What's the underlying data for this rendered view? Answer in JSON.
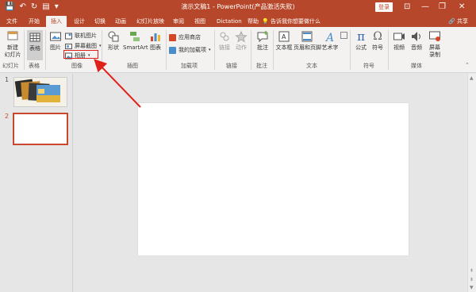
{
  "window": {
    "title": "演示文稿1  -  PowerPoint(产品激活失败)",
    "login_label": "登录",
    "minimize": "—",
    "restore": "❐",
    "close": "✕",
    "ribbon_options": "⊡"
  },
  "quick_access": {
    "save": "💾",
    "undo": "↶",
    "redo": "↻",
    "start": "▤",
    "more": "▾"
  },
  "tabs": [
    {
      "label": "文件"
    },
    {
      "label": "开始"
    },
    {
      "label": "插入"
    },
    {
      "label": "设计"
    },
    {
      "label": "切换"
    },
    {
      "label": "动画"
    },
    {
      "label": "幻灯片放映"
    },
    {
      "label": "审阅"
    },
    {
      "label": "视图"
    },
    {
      "label": "Dictation"
    },
    {
      "label": "帮助"
    }
  ],
  "active_tab": "插入",
  "tell_me": "💡 告诉我你想要做什么",
  "share": "🔗 共享",
  "ribbon": {
    "new_slide": "新建\n幻灯片",
    "table": "表格",
    "picture": "图片",
    "online_pictures": "联机图片",
    "screenshot": "屏幕截图",
    "album": "相册",
    "shapes": "形状",
    "smartart": "SmartArt",
    "chart": "图表",
    "store": "应用商店",
    "my_addins": "我的加载项",
    "link": "链接",
    "action": "动作",
    "comment": "批注",
    "textbox": "文本框",
    "header_footer": "页眉和页脚",
    "wordart": "艺术字",
    "equation": "公式",
    "symbol": "符号",
    "video": "视频",
    "audio": "音频",
    "screen_recording": "屏幕\n录制"
  },
  "groups": {
    "slides": "幻灯片",
    "tables": "表格",
    "images": "图像",
    "illustrations": "插图",
    "addins": "加载项",
    "links": "链接",
    "comments": "批注",
    "text": "文本",
    "symbols": "符号",
    "media": "媒体"
  },
  "slides": [
    {
      "number": "1"
    },
    {
      "number": "2"
    }
  ],
  "colors": {
    "accent": "#b7472a",
    "highlight": "#e0201b",
    "selected_slide_border": "#c9472c"
  }
}
